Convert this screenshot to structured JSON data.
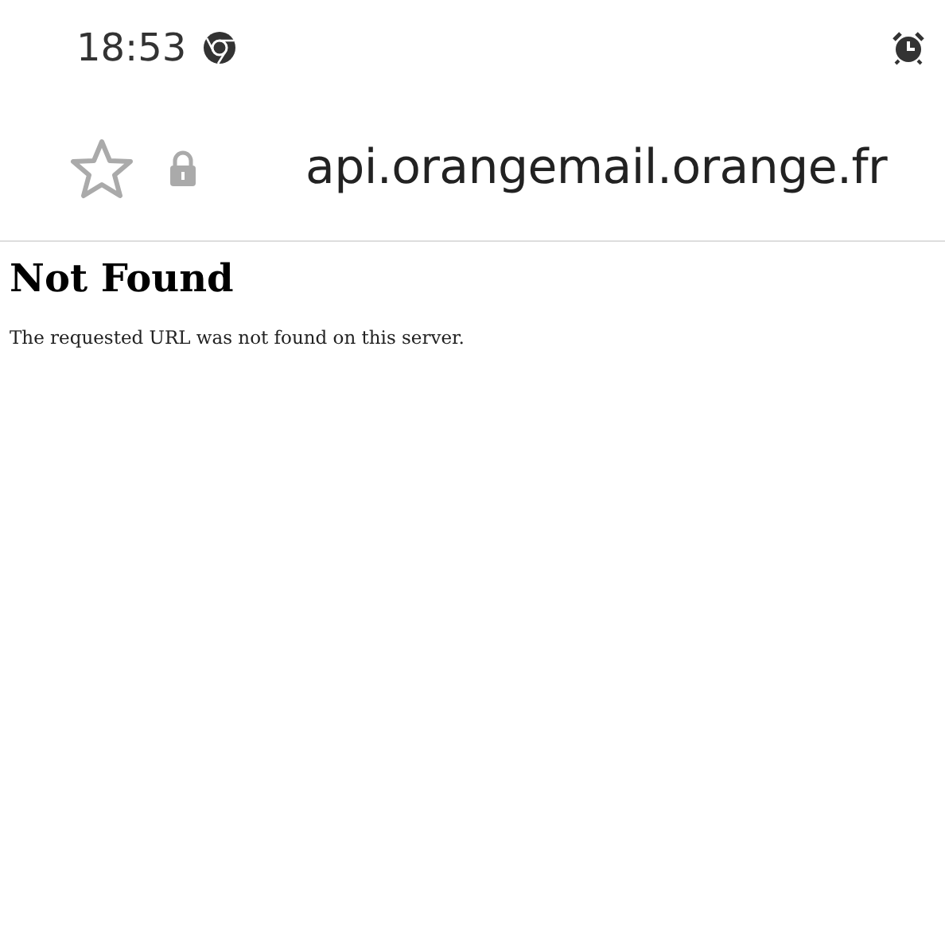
{
  "status_bar": {
    "time": "18:53"
  },
  "address_bar": {
    "bookmarked": false,
    "url": "api.orangemail.orange.fr"
  },
  "page": {
    "heading": "Not Found",
    "message": "The requested URL was not found on this server."
  }
}
